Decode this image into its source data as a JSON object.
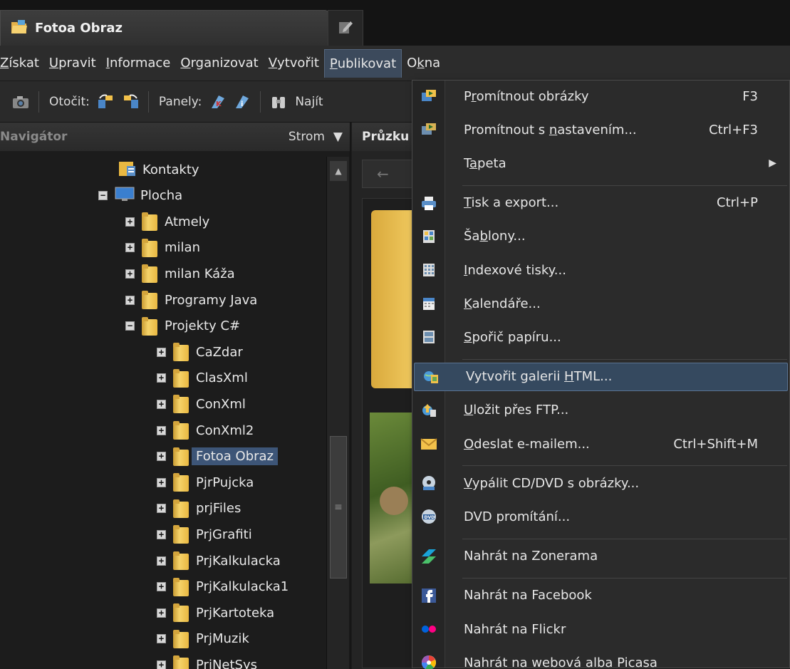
{
  "window": {
    "tab_title": "Fotoa Obraz"
  },
  "menubar": {
    "items": [
      {
        "pre": "",
        "ul": "Z",
        "post": "ískat"
      },
      {
        "pre": "",
        "ul": "U",
        "post": "pravit"
      },
      {
        "pre": "",
        "ul": "I",
        "post": "nformace"
      },
      {
        "pre": "",
        "ul": "O",
        "post": "rganizovat"
      },
      {
        "pre": "",
        "ul": "V",
        "post": "ytvořit"
      },
      {
        "pre": "",
        "ul": "P",
        "post": "ublikovat"
      },
      {
        "pre": "O",
        "ul": "k",
        "post": "na"
      }
    ]
  },
  "toolbar": {
    "rotate_label": "Otočit:",
    "panels_label": "Panely:",
    "find_label": "Najít"
  },
  "navigator": {
    "title": "Navigátor",
    "mode": "Strom",
    "tree": [
      {
        "label": "Kontakty",
        "indent": 1,
        "toggle": "",
        "type": "contacts"
      },
      {
        "label": "Plocha",
        "indent": 0,
        "toggle": "−",
        "type": "desktop"
      },
      {
        "label": "Atmely",
        "indent": 1,
        "toggle": "+",
        "type": "folder"
      },
      {
        "label": "milan",
        "indent": 1,
        "toggle": "+",
        "type": "folder"
      },
      {
        "label": "milan Káža",
        "indent": 1,
        "toggle": "+",
        "type": "folder"
      },
      {
        "label": "Programy Java",
        "indent": 1,
        "toggle": "+",
        "type": "folder"
      },
      {
        "label": "Projekty C#",
        "indent": 1,
        "toggle": "−",
        "type": "folder"
      },
      {
        "label": "CaZdar",
        "indent": 2,
        "toggle": "+",
        "type": "folder"
      },
      {
        "label": "ClasXml",
        "indent": 2,
        "toggle": "+",
        "type": "folder"
      },
      {
        "label": "ConXml",
        "indent": 2,
        "toggle": "+",
        "type": "folder"
      },
      {
        "label": "ConXml2",
        "indent": 2,
        "toggle": "+",
        "type": "folder"
      },
      {
        "label": "Fotoa Obraz",
        "indent": 2,
        "toggle": "+",
        "type": "folder",
        "selected": true
      },
      {
        "label": "PjrPujcka",
        "indent": 2,
        "toggle": "+",
        "type": "folder"
      },
      {
        "label": "prjFiles",
        "indent": 2,
        "toggle": "+",
        "type": "folder"
      },
      {
        "label": "PrjGrafiti",
        "indent": 2,
        "toggle": "+",
        "type": "folder"
      },
      {
        "label": "PrjKalkulacka",
        "indent": 2,
        "toggle": "+",
        "type": "folder"
      },
      {
        "label": "PrjKalkulacka1",
        "indent": 2,
        "toggle": "+",
        "type": "folder"
      },
      {
        "label": "PrjKartoteka",
        "indent": 2,
        "toggle": "+",
        "type": "folder"
      },
      {
        "label": "PrjMuzik",
        "indent": 2,
        "toggle": "+",
        "type": "folder"
      },
      {
        "label": "PrjNetSys",
        "indent": 2,
        "toggle": "+",
        "type": "folder"
      }
    ]
  },
  "explorer": {
    "title": "Průzku"
  },
  "publish_menu": {
    "items": [
      {
        "pre": "P",
        "ul": "r",
        "post": "omítnout obrázky",
        "shortcut": "F3",
        "icon": "slideshow-icon"
      },
      {
        "pre": "Promítnout s ",
        "ul": "n",
        "post": "astavením...",
        "shortcut": "Ctrl+F3",
        "icon": "slideshow-settings-icon"
      },
      {
        "pre": "T",
        "ul": "a",
        "post": "peta",
        "shortcut": "",
        "icon": "",
        "submenu": true
      },
      {
        "pre": "",
        "ul": "T",
        "post": "isk a export...",
        "shortcut": "Ctrl+P",
        "icon": "printer-icon",
        "sep_before": true
      },
      {
        "pre": "Ša",
        "ul": "b",
        "post": "lony...",
        "shortcut": "",
        "icon": "templates-icon"
      },
      {
        "pre": "",
        "ul": "I",
        "post": "ndexové tisky...",
        "shortcut": "",
        "icon": "index-print-icon"
      },
      {
        "pre": "",
        "ul": "K",
        "post": "alendáře...",
        "shortcut": "",
        "icon": "calendar-icon"
      },
      {
        "pre": "",
        "ul": "S",
        "post": "pořič papíru...",
        "shortcut": "",
        "icon": "paper-saver-icon"
      },
      {
        "pre": "Vytvořit galerii ",
        "ul": "H",
        "post": "TML...",
        "shortcut": "",
        "icon": "html-gallery-icon",
        "sep_before": true,
        "highlight": true
      },
      {
        "pre": "",
        "ul": "U",
        "post": "ložit přes FTP...",
        "shortcut": "",
        "icon": "ftp-icon"
      },
      {
        "pre": "",
        "ul": "O",
        "post": "deslat e-mailem...",
        "shortcut": "Ctrl+Shift+M",
        "icon": "email-icon"
      },
      {
        "pre": "",
        "ul": "V",
        "post": "ypálit CD/DVD s obrázky...",
        "shortcut": "",
        "icon": "burn-disc-icon",
        "sep_before": true
      },
      {
        "pre": "DVD promítání...",
        "ul": "",
        "post": "",
        "shortcut": "",
        "icon": "dvd-icon"
      },
      {
        "pre": "Nahrát na Zonerama",
        "ul": "",
        "post": "",
        "shortcut": "",
        "icon": "zonerama-icon",
        "sep_before": true
      },
      {
        "pre": "Nahrát na Facebook",
        "ul": "",
        "post": "",
        "shortcut": "",
        "icon": "facebook-icon",
        "sep_before": true
      },
      {
        "pre": "Nahrát na Flickr",
        "ul": "",
        "post": "",
        "shortcut": "",
        "icon": "flickr-icon"
      },
      {
        "pre": "Nahrát na webová alba Picasa",
        "ul": "",
        "post": "",
        "shortcut": "",
        "icon": "picasa-icon"
      }
    ]
  }
}
